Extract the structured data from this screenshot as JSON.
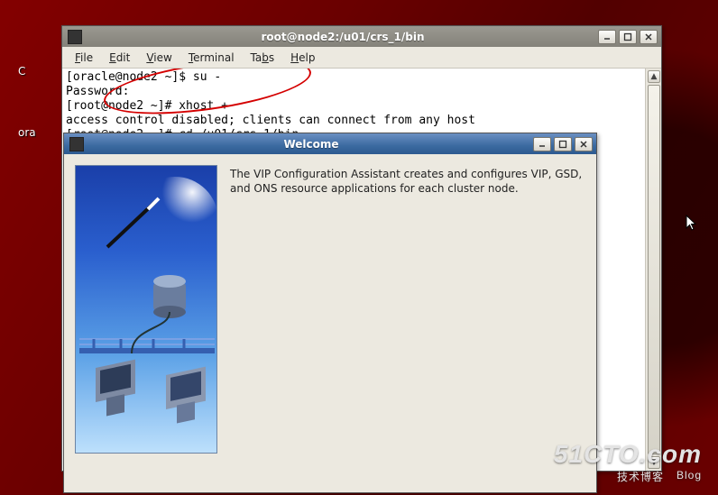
{
  "desktop": {
    "left_labels": [
      "C",
      "ora"
    ]
  },
  "terminal": {
    "title": "root@node2:/u01/crs_1/bin",
    "menu": {
      "file": "File",
      "edit": "Edit",
      "view": "View",
      "terminal": "Terminal",
      "tabs": "Tabs",
      "help": "Help"
    },
    "lines": [
      "[oracle@node2 ~]$ su -",
      "Password:",
      "[root@node2 ~]# xhost +",
      "access control disabled; clients can connect from any host",
      "[root@node2 ~]# cd /u01/crs_1/bin"
    ]
  },
  "welcome": {
    "title": "Welcome",
    "text": "The VIP Configuration Assistant creates and configures VIP, GSD, and ONS resource applications for each cluster node."
  },
  "watermark": {
    "brand": "51CTO.com",
    "sub1": "技术博客",
    "sub2": "Blog"
  }
}
